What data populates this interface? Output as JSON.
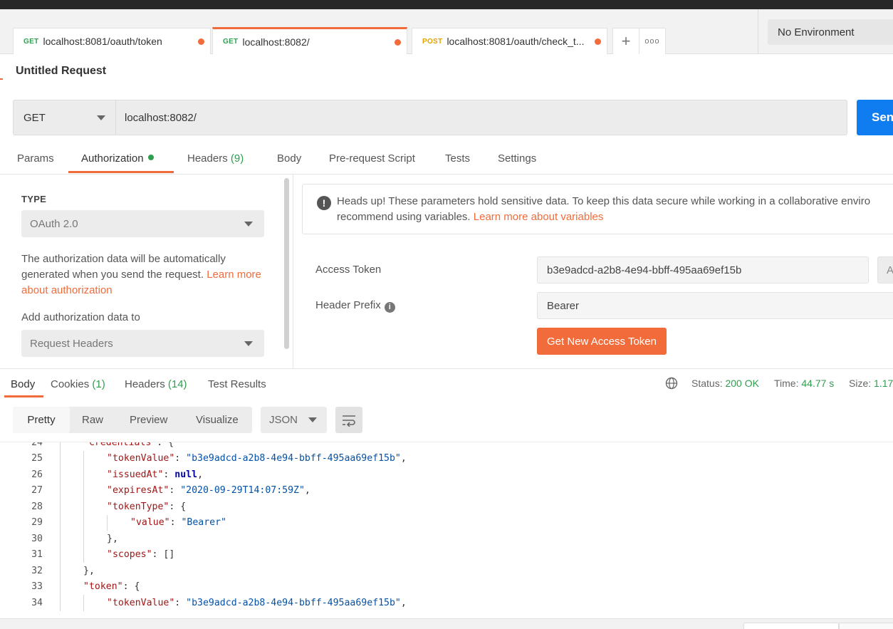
{
  "tabs": [
    {
      "method": "GET",
      "url": "localhost:8081/oauth/token"
    },
    {
      "method": "GET",
      "url": "localhost:8082/"
    },
    {
      "method": "POST",
      "url": "localhost:8081/oauth/check_t..."
    }
  ],
  "tab_actions": {
    "add": "+",
    "more": "ooo"
  },
  "environment": "No Environment",
  "request": {
    "title": "Untitled Request",
    "method": "GET",
    "url": "localhost:8082/",
    "send_label": "Send"
  },
  "request_tabs": {
    "params": "Params",
    "authorization": "Authorization",
    "headers": "Headers",
    "headers_count": "(9)",
    "body": "Body",
    "prerequest": "Pre-request Script",
    "tests": "Tests",
    "settings": "Settings"
  },
  "auth": {
    "type_label": "TYPE",
    "type_value": "OAuth 2.0",
    "desc_text": "The authorization data will be automatically generated when you send the request. ",
    "desc_link": "Learn more about authorization",
    "add_to_label": "Add authorization data to",
    "add_to_value": "Request Headers",
    "notice_text_1": "Heads up! These parameters hold sensitive data. To keep this data secure while working in a collaborative enviro",
    "notice_text_2": "recommend using variables. ",
    "notice_link": "Learn more about variables",
    "access_token_label": "Access Token",
    "access_token_value": "b3e9adcd-a2b8-4e94-bbff-495aa69ef15b",
    "access_token_extra": "A",
    "header_prefix_label": "Header Prefix",
    "header_prefix_value": "Bearer",
    "get_token_label": "Get New Access Token"
  },
  "response_tabs": {
    "body": "Body",
    "cookies": "Cookies",
    "cookies_count": "(1)",
    "headers": "Headers",
    "headers_count": "(14)",
    "test_results": "Test Results"
  },
  "response_stats": {
    "status_label": "Status:",
    "status_value": "200 OK",
    "time_label": "Time:",
    "time_value": "44.77 s",
    "size_label": "Size:",
    "size_value": "1.17"
  },
  "format": {
    "pretty": "Pretty",
    "raw": "Raw",
    "preview": "Preview",
    "visualize": "Visualize",
    "lang": "JSON"
  },
  "code_lines": [
    {
      "n": "24",
      "key": "\"credentials\"",
      "punct": ": {",
      "indent": 1
    },
    {
      "n": "25",
      "key": "\"tokenValue\"",
      "punct": ": ",
      "str": "\"b3e9adcd-a2b8-4e94-bbff-495aa69ef15b\"",
      "tail": ",",
      "indent": 2
    },
    {
      "n": "26",
      "key": "\"issuedAt\"",
      "punct": ": ",
      "bool": "null",
      "tail": ",",
      "indent": 2
    },
    {
      "n": "27",
      "key": "\"expiresAt\"",
      "punct": ": ",
      "str": "\"2020-09-29T14:07:59Z\"",
      "tail": ",",
      "indent": 2
    },
    {
      "n": "28",
      "key": "\"tokenType\"",
      "punct": ": {",
      "indent": 2
    },
    {
      "n": "29",
      "key": "\"value\"",
      "punct": ": ",
      "str": "\"Bearer\"",
      "indent": 3
    },
    {
      "n": "30",
      "plain": "},",
      "indent": 2
    },
    {
      "n": "31",
      "key": "\"scopes\"",
      "punct": ": []",
      "indent": 2
    },
    {
      "n": "32",
      "plain": "},",
      "indent": 1
    },
    {
      "n": "33",
      "key": "\"token\"",
      "punct": ": {",
      "indent": 1
    },
    {
      "n": "34",
      "key": "\"tokenValue\"",
      "punct": ": ",
      "str": "\"b3e9adcd-a2b8-4e94-bbff-495aa69ef15b\"",
      "tail": ",",
      "indent": 2
    }
  ]
}
